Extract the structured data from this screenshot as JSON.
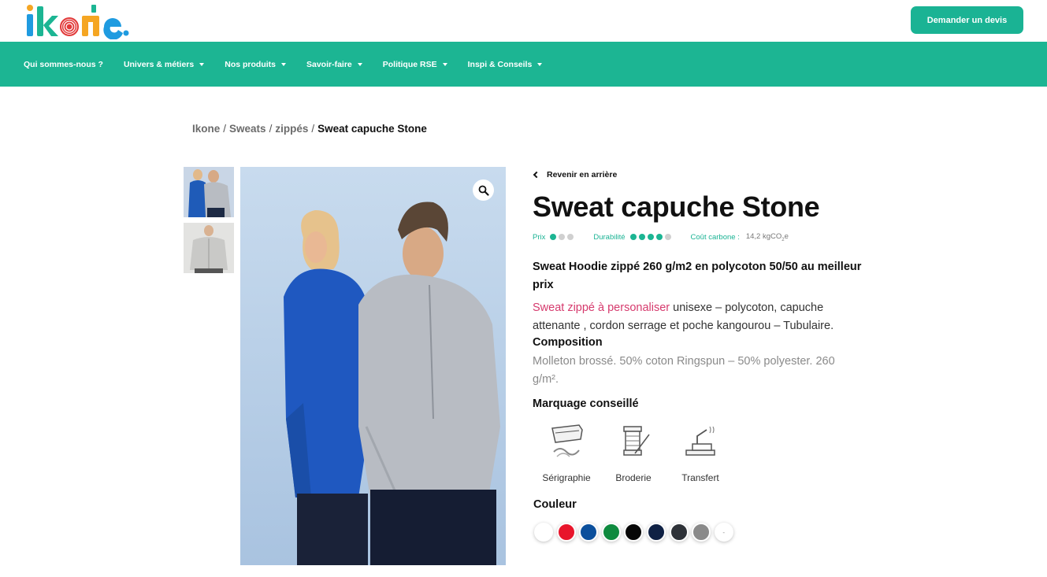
{
  "header": {
    "logo_text": "ikone",
    "quote_button": "Demander un devis"
  },
  "nav": {
    "items": [
      {
        "label": "Qui sommes-nous ?",
        "dropdown": false
      },
      {
        "label": "Univers & métiers",
        "dropdown": true
      },
      {
        "label": "Nos produits",
        "dropdown": true
      },
      {
        "label": "Savoir-faire",
        "dropdown": true
      },
      {
        "label": "Politique RSE",
        "dropdown": true
      },
      {
        "label": "Inspi & Conseils",
        "dropdown": true
      }
    ]
  },
  "breadcrumb": {
    "items": [
      "Ikone",
      "Sweats",
      "zippés"
    ],
    "separator": "/",
    "current": "Sweat capuche Stone"
  },
  "product": {
    "back_label": "Revenir en arrière",
    "title": "Sweat capuche Stone",
    "ratings": {
      "price_label": "Prix",
      "price_score": 1,
      "price_max": 3,
      "durability_label": "Durabilité",
      "durability_score": 4,
      "durability_max": 5,
      "carbon_label": "Coût carbone :",
      "carbon_value": "14,2 kgCO",
      "carbon_sub": "2",
      "carbon_suffix": "e"
    },
    "subtitle": "Sweat Hoodie zippé 260 g/m2 en polycoton 50/50 au meilleur prix",
    "description_link": "Sweat zippé à personaliser",
    "description_rest": " unisexe – polycoton, capuche attenante , cordon serrage et poche kangourou – Tubulaire.",
    "composition_title": "Composition",
    "composition_text": "Molleton brossé. 50% coton Ringspun – 50% polyester. 260 g/m².",
    "marking_title": "Marquage conseillé",
    "markings": [
      {
        "label": "Sérigraphie",
        "icon": "screen-printing-icon"
      },
      {
        "label": "Broderie",
        "icon": "embroidery-icon"
      },
      {
        "label": "Transfert",
        "icon": "transfer-press-icon"
      }
    ],
    "color_title": "Couleur",
    "colors": [
      "#ffffff",
      "#e8152b",
      "#0b4f9c",
      "#0e8a3e",
      "#060606",
      "#0f2144",
      "#2e3238",
      "#8a8a8a"
    ],
    "more_colors": "-"
  },
  "theme": {
    "accent": "#1cb593",
    "link": "#d63a6d"
  }
}
